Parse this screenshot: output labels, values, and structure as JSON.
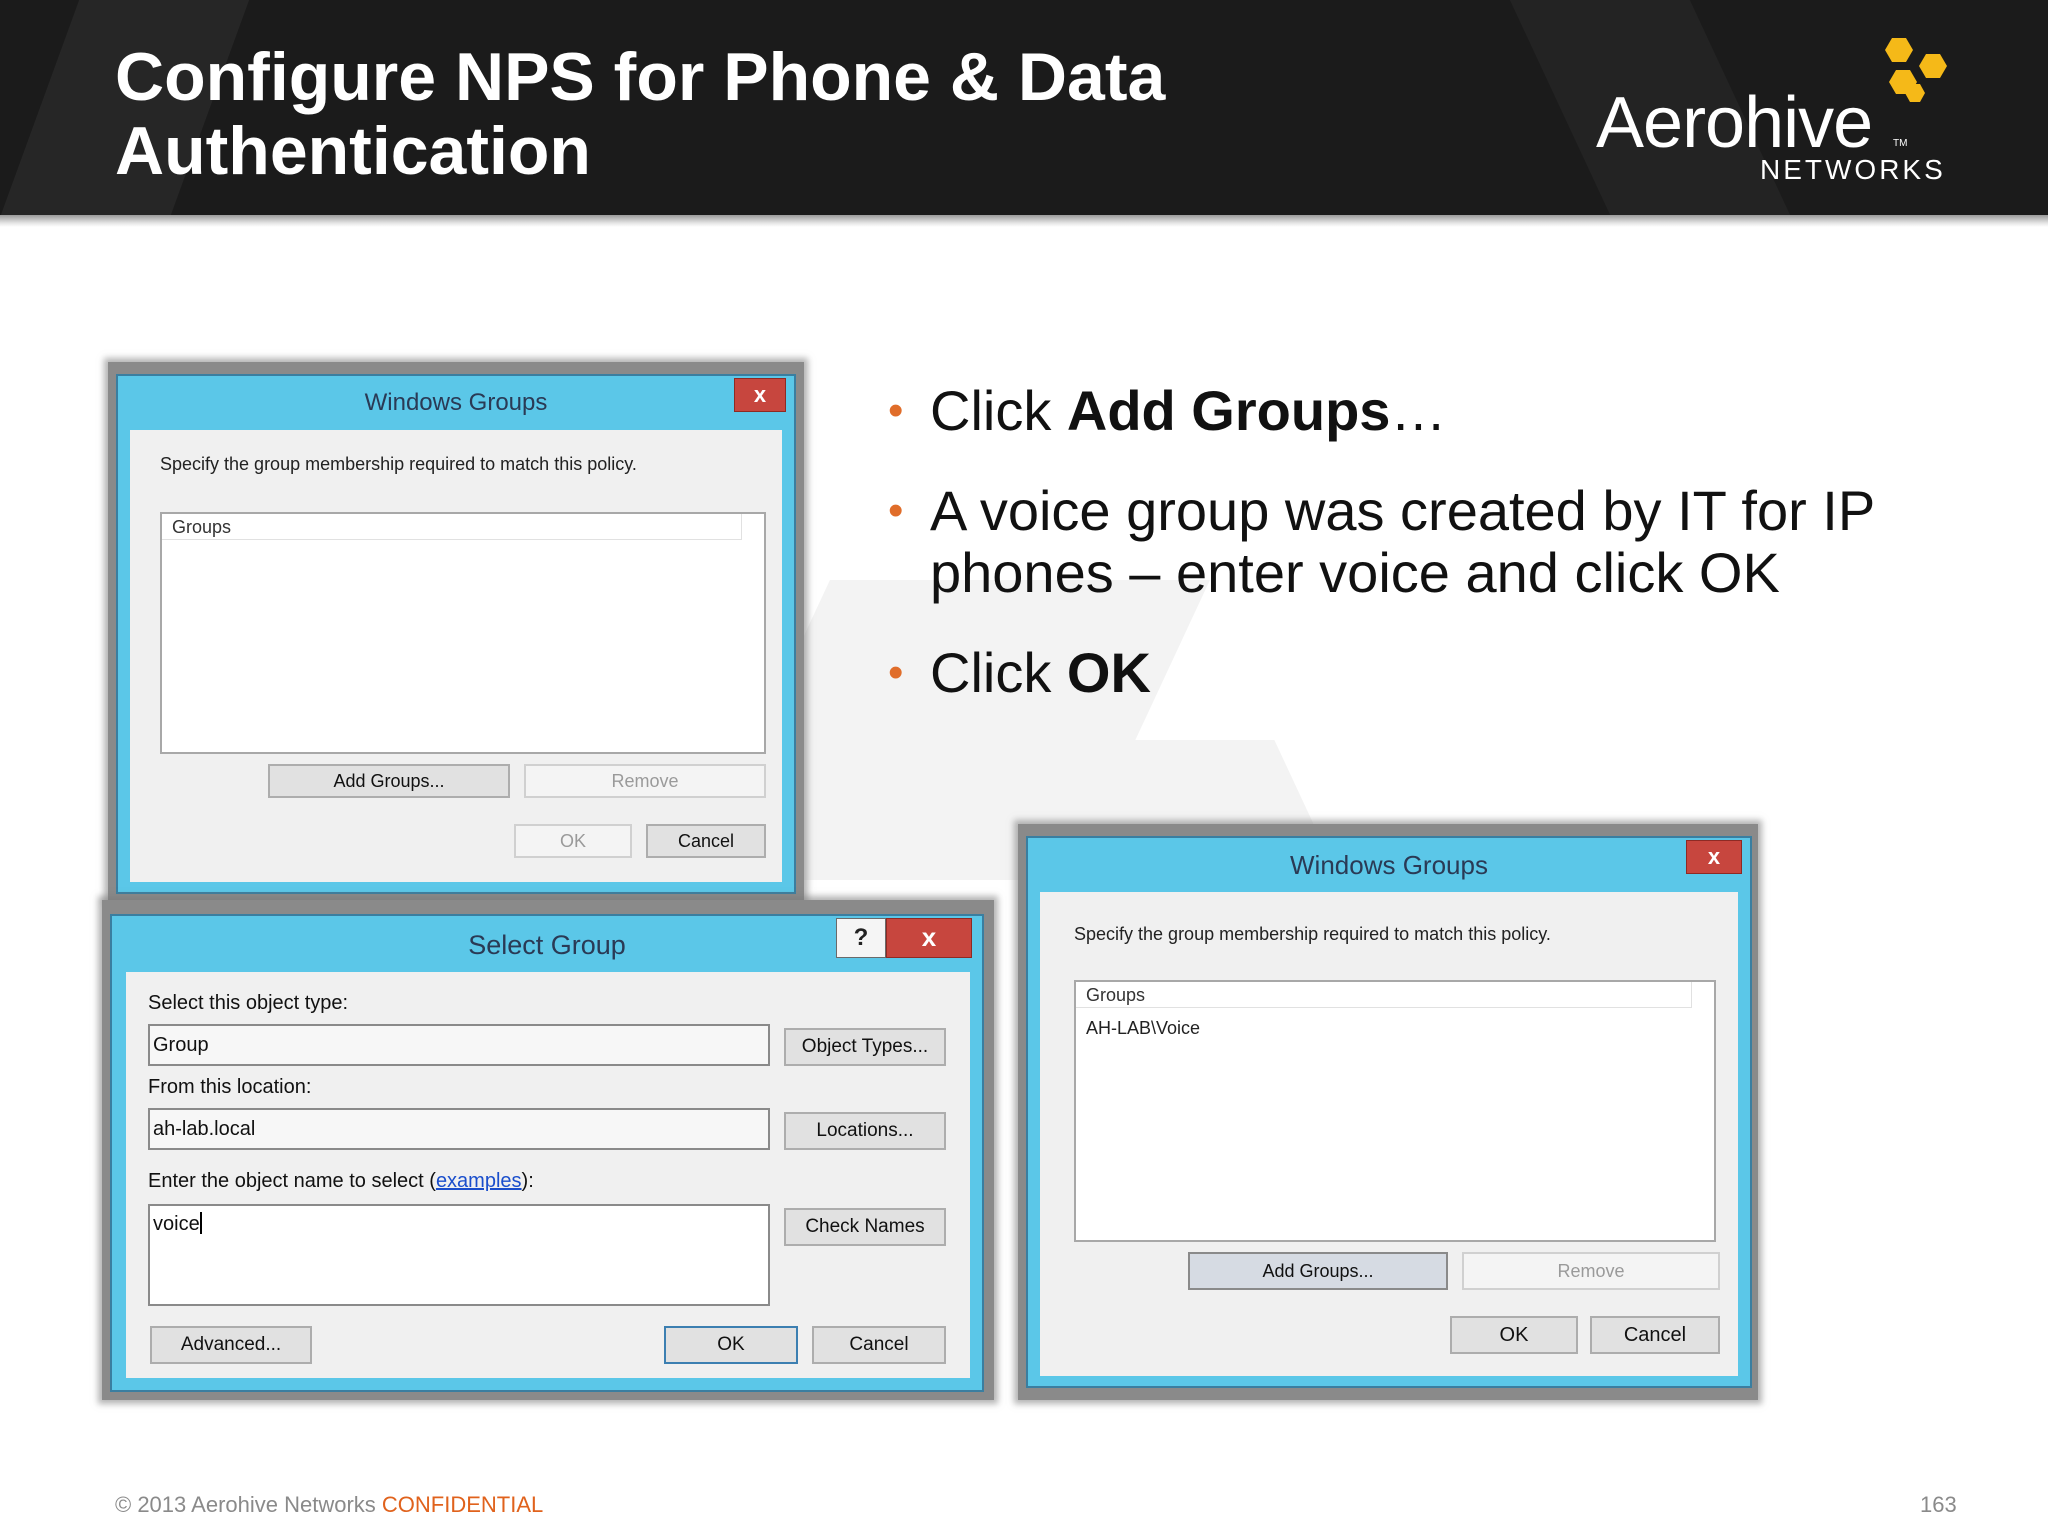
{
  "slide": {
    "title_line1": "Configure NPS for Phone & Data",
    "title_line2": "Authentication",
    "logo_name": "Aerohive",
    "logo_sub": "NETWORKS",
    "logo_tm": "TM"
  },
  "bullets": [
    {
      "pre": "Click ",
      "bold": "Add Groups",
      "post": "…"
    },
    {
      "pre": "A voice group was created by IT for IP phones – enter voice and click OK",
      "bold": "",
      "post": ""
    },
    {
      "pre": "Click ",
      "bold": "OK",
      "post": ""
    }
  ],
  "dialog_top_left": {
    "title": "Windows Groups",
    "close": "x",
    "description": "Specify the group membership required to match this policy.",
    "list_header": "Groups",
    "add_groups": "Add Groups...",
    "remove": "Remove",
    "ok": "OK",
    "cancel": "Cancel"
  },
  "dialog_select_group": {
    "title": "Select Group",
    "help": "?",
    "close": "x",
    "object_type_label": "Select this object type:",
    "object_type_value": "Group",
    "object_types_button": "Object Types...",
    "location_label": "From this location:",
    "location_value": "ah-lab.local",
    "locations_button": "Locations...",
    "enter_label_pre": "Enter the object name to select (",
    "enter_label_link": "examples",
    "enter_label_post": "):",
    "name_value": "voice",
    "check_names_button": "Check Names",
    "advanced_button": "Advanced...",
    "ok": "OK",
    "cancel": "Cancel"
  },
  "dialog_right": {
    "title": "Windows Groups",
    "close": "x",
    "description": "Specify the group membership required to match this policy.",
    "list_header": "Groups",
    "list_items": [
      "AH-LAB\\Voice"
    ],
    "add_groups": "Add Groups...",
    "remove": "Remove",
    "ok": "OK",
    "cancel": "Cancel"
  },
  "footer": {
    "copyright": "© 2013 Aerohive Networks ",
    "confidential": "CONFIDENTIAL",
    "page_number": "163"
  },
  "colors": {
    "header_bg": "#1b1b1b",
    "accent_orange": "#e06d2a",
    "logo_yellow": "#f5b918",
    "dialog_frame": "#5bc7e8",
    "close_red": "#c7463e"
  }
}
